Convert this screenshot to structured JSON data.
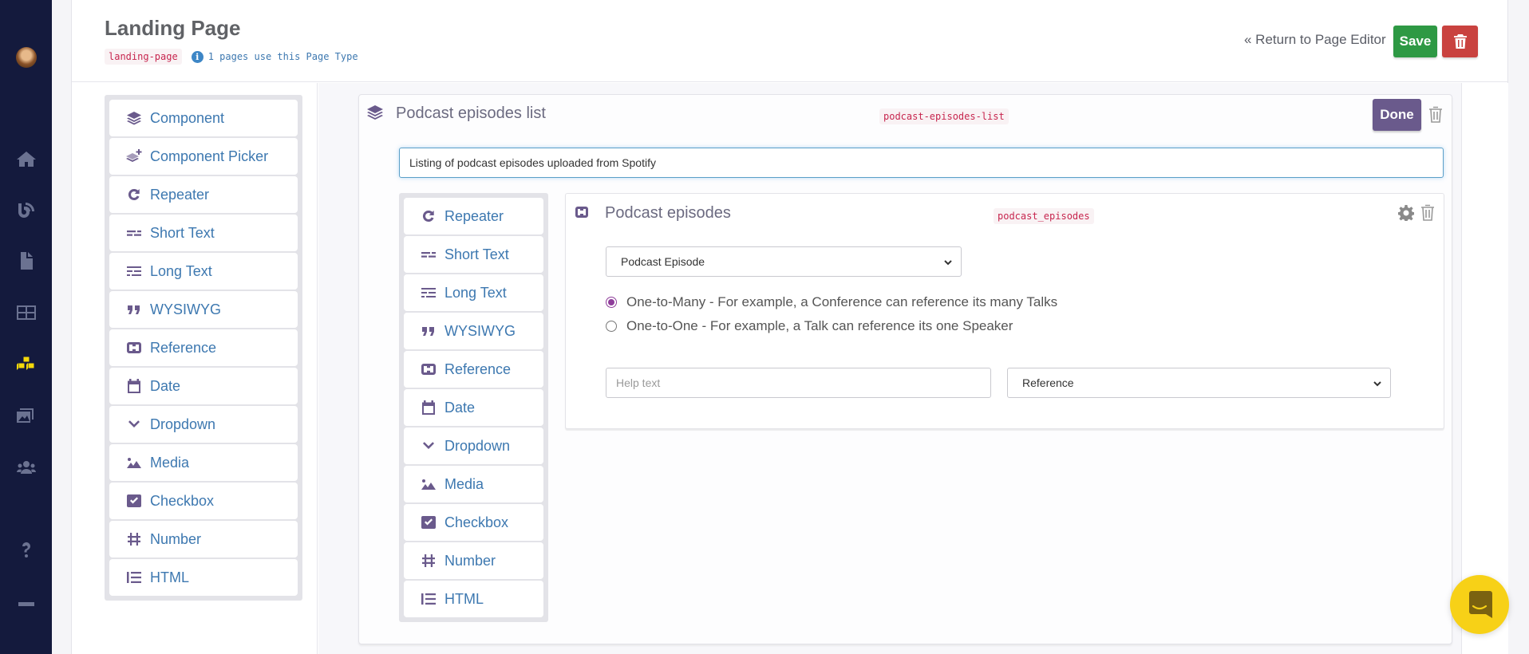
{
  "sidebar": {
    "avatar_alt": "User avatar",
    "nav": [
      {
        "name": "home-icon",
        "active": false
      },
      {
        "name": "blog-feed-icon",
        "active": false
      },
      {
        "name": "page-icon",
        "active": false
      },
      {
        "name": "layout-grid-icon",
        "active": false
      },
      {
        "name": "components-cubes-icon",
        "active": true
      },
      {
        "name": "media-gallery-icon",
        "active": false
      },
      {
        "name": "users-group-icon",
        "active": false
      },
      {
        "name": "help-question-icon",
        "active": false
      },
      {
        "name": "collapse-bar-icon",
        "active": false
      }
    ],
    "active_color": "#f5d90a"
  },
  "header": {
    "title": "Landing Page",
    "slug": "landing-page",
    "usage_text": "1 pages use this Page Type",
    "info_icon": "i",
    "return_link": "« Return to Page Editor",
    "save_label": "Save",
    "delete_icon": "trash-icon"
  },
  "left_fields": [
    {
      "icon": "layers-icon",
      "label": "Component"
    },
    {
      "icon": "layers-plus-icon",
      "label": "Component Picker"
    },
    {
      "icon": "redo-icon",
      "label": "Repeater"
    },
    {
      "icon": "short-text-icon",
      "label": "Short Text"
    },
    {
      "icon": "long-text-icon",
      "label": "Long Text"
    },
    {
      "icon": "quote-icon",
      "label": "WYSIWYG"
    },
    {
      "icon": "link-icon",
      "label": "Reference"
    },
    {
      "icon": "calendar-icon",
      "label": "Date"
    },
    {
      "icon": "chevron-down-icon",
      "label": "Dropdown"
    },
    {
      "icon": "image-icon",
      "label": "Media"
    },
    {
      "icon": "checkbox-icon",
      "label": "Checkbox"
    },
    {
      "icon": "hash-icon",
      "label": "Number"
    },
    {
      "icon": "list-icon",
      "label": "HTML"
    }
  ],
  "component": {
    "title": "Podcast episodes list",
    "key": "podcast-episodes-list",
    "done_label": "Done",
    "description": "Listing of podcast episodes uploaded from Spotify",
    "inner_fields": [
      {
        "icon": "redo-icon",
        "label": "Repeater"
      },
      {
        "icon": "short-text-icon",
        "label": "Short Text"
      },
      {
        "icon": "long-text-icon",
        "label": "Long Text"
      },
      {
        "icon": "quote-icon",
        "label": "WYSIWYG"
      },
      {
        "icon": "link-icon",
        "label": "Reference"
      },
      {
        "icon": "calendar-icon",
        "label": "Date"
      },
      {
        "icon": "chevron-down-icon",
        "label": "Dropdown"
      },
      {
        "icon": "image-icon",
        "label": "Media"
      },
      {
        "icon": "checkbox-icon",
        "label": "Checkbox"
      },
      {
        "icon": "hash-icon",
        "label": "Number"
      },
      {
        "icon": "list-icon",
        "label": "HTML"
      }
    ],
    "reference_field": {
      "title": "Podcast episodes",
      "key": "podcast_episodes",
      "target_select": "Podcast Episode",
      "relations": [
        {
          "label": "One-to-Many - For example, a Conference can reference its many Talks",
          "checked": true
        },
        {
          "label": "One-to-One - For example, a Talk can reference its one Speaker",
          "checked": false
        }
      ],
      "help_text_value": "",
      "help_text_placeholder": "Help text",
      "type_select": "Reference"
    }
  },
  "colors": {
    "sidebar_bg": "#141a3d",
    "save": "#2e9944",
    "danger": "#c9423f",
    "done": "#6a5a8c",
    "link": "#3d78b0",
    "code": "#c7254e",
    "chat": "#f7d117"
  }
}
